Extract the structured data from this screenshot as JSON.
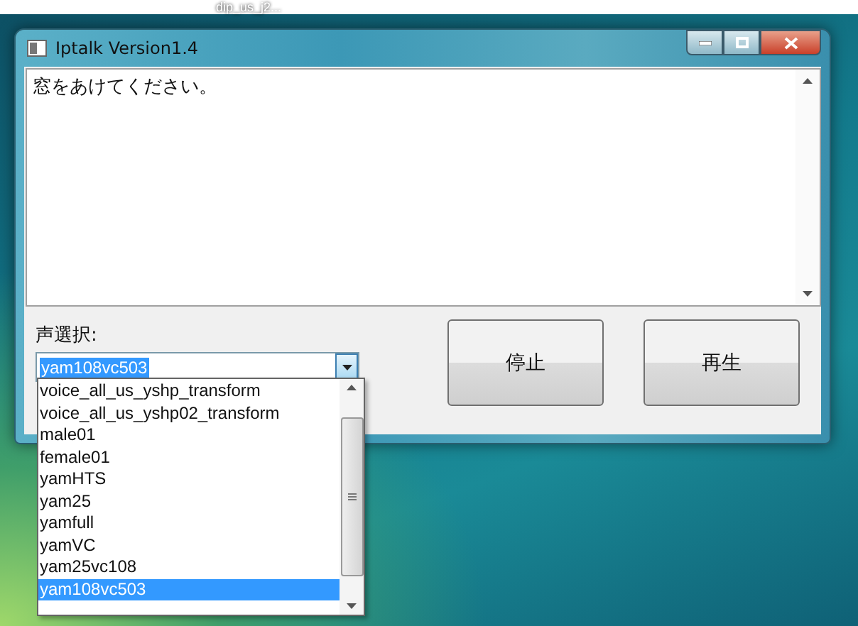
{
  "desktop": {
    "icon_label": "dip_us_j2..."
  },
  "window": {
    "title": "Iptalk Version1.4"
  },
  "message": {
    "value": "窓をあけてください。"
  },
  "voice_select": {
    "label": "声選択:",
    "value": "yam108vc503",
    "expanded": true,
    "options": [
      {
        "label": "voice_all_us_yshp_transform",
        "selected": false
      },
      {
        "label": "voice_all_us_yshp02_transform",
        "selected": false
      },
      {
        "label": "male01",
        "selected": false
      },
      {
        "label": "female01",
        "selected": false
      },
      {
        "label": "yamHTS",
        "selected": false
      },
      {
        "label": "yam25",
        "selected": false
      },
      {
        "label": "yamfull",
        "selected": false
      },
      {
        "label": "yamVC",
        "selected": false
      },
      {
        "label": "yam25vc108",
        "selected": false
      },
      {
        "label": "yam108vc503",
        "selected": true
      }
    ]
  },
  "buttons": [
    "停止",
    "再生"
  ]
}
